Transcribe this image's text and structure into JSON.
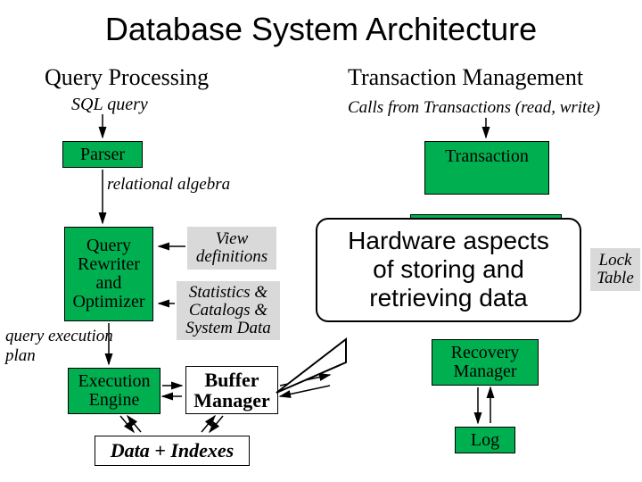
{
  "title": "Database System Architecture",
  "left": {
    "heading": "Query Processing",
    "input_label": "SQL query",
    "parser": "Parser",
    "rel_alg": "relational algebra",
    "optimizer": "Query\nRewriter\nand\nOptimizer",
    "view_defs": "View\ndefinitions",
    "stats": "Statistics &\nCatalogs &\nSystem Data",
    "qep": "query execution\nplan",
    "exec": "Execution\nEngine",
    "bufmgr": "Buffer\nManager",
    "data_idx": "Data + Indexes"
  },
  "right": {
    "heading": "Transaction Management",
    "input_label": "Calls from Transactions (read, write)",
    "txn": "Transaction",
    "recovery": "Recovery\nManager",
    "lock_table": "Lock\nTable",
    "log": "Log"
  },
  "callout": "Hardware aspects\nof storing and\nretrieving data"
}
